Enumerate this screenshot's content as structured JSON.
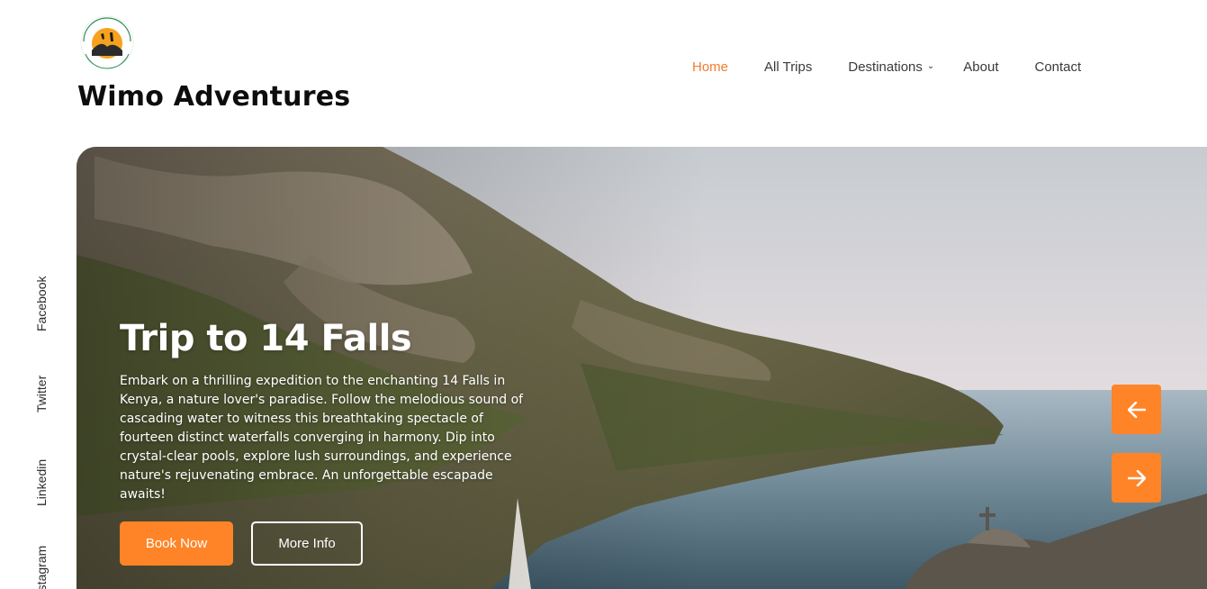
{
  "brand": {
    "logo_text": "WIMO ADVENTURES",
    "name": "Wimo Adventures"
  },
  "nav": {
    "items": [
      {
        "label": "Home",
        "active": true
      },
      {
        "label": "All Trips"
      },
      {
        "label": "Destinations",
        "has_dropdown": true
      },
      {
        "label": "About"
      },
      {
        "label": "Contact"
      }
    ]
  },
  "social": {
    "links": [
      "Facebook",
      "Twitter",
      "Linkedin",
      "Instagram"
    ]
  },
  "hero": {
    "title": "Trip to 14 Falls",
    "description": "Embark on a thrilling expedition to the enchanting 14 Falls in Kenya, a nature lover's paradise. Follow the melodious sound of cascading water to witness this breathtaking spectacle of fourteen distinct waterfalls converging in harmony. Dip into crystal-clear pools, explore lush surroundings, and experience nature's rejuvenating embrace. An unforgettable escapade awaits!",
    "book_label": "Book Now",
    "info_label": "More Info",
    "prev_icon": "arrow-left-icon",
    "next_icon": "arrow-right-icon"
  },
  "colors": {
    "accent": "#ff8427",
    "nav_active": "#f47c2c"
  }
}
